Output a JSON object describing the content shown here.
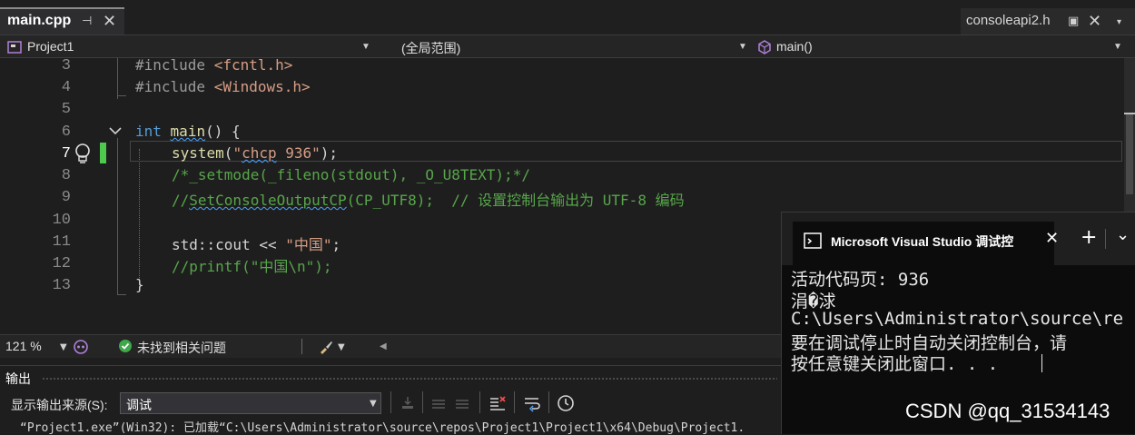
{
  "tabs": {
    "active": {
      "label": "main.cpp",
      "pin": "⊣",
      "close": "✕"
    },
    "right": {
      "label": "consoleapi2.h",
      "pin": "▣",
      "close": "✕",
      "overflow": "▾"
    }
  },
  "navbar": {
    "project": "Project1",
    "scope": "(全局范围)",
    "member": "main()"
  },
  "editor": {
    "lines": [
      {
        "num": "3"
      },
      {
        "num": "4"
      },
      {
        "num": "5"
      },
      {
        "num": "6"
      },
      {
        "num": "7"
      },
      {
        "num": "8"
      },
      {
        "num": "9"
      },
      {
        "num": "10"
      },
      {
        "num": "11"
      },
      {
        "num": "12"
      },
      {
        "num": "13"
      }
    ],
    "code": {
      "l3_pp": "#include ",
      "l3_inc": "<fcntl.h>",
      "l4_pp": "#include ",
      "l4_inc": "<Windows.h>",
      "l6_kw": "int",
      "l6_fn": "main",
      "l6_rest": "() {",
      "l7_fn": "system",
      "l7_open": "(",
      "l7_str_a": "\"",
      "l7_str_b": "chcp",
      "l7_str_c": " 936\"",
      "l7_close": ");",
      "l8_cm": "/*_setmode(_fileno(stdout), _O_U8TEXT);*/",
      "l9_cm_a": "//",
      "l9_cm_b": "SetConsoleOutputCP",
      "l9_cm_c": "(CP_UTF8);  // 设置控制台输出为 UTF-8 编码",
      "l11_a": "std::cout << ",
      "l11_str": "\"中国\"",
      "l11_b": ";",
      "l12_cm": "//printf(\"中国\\n\");",
      "l13": "}"
    }
  },
  "statusbar": {
    "zoom": "121 %",
    "issues": "未找到相关问题"
  },
  "output": {
    "title": "输出",
    "source_label": "显示输出来源(S):",
    "source_value": "调试",
    "line": "“Project1.exe”(Win32): 已加载“C:\\Users\\Administrator\\source\\repos\\Project1\\Project1\\x64\\Debug\\Project1."
  },
  "console": {
    "title": "Microsoft Visual Studio 调试控",
    "close": "✕",
    "add": "+",
    "dropdown": "⌄",
    "lines": [
      "活动代码页: 936",
      "涓�浗",
      "C:\\Users\\Administrator\\source\\re",
      "要在调试停止时自动关闭控制台，请",
      "按任意键关闭此窗口. . ."
    ]
  },
  "watermark": "CSDN @qq_31534143",
  "colors": {
    "accent_green": "#4ec94e",
    "keyword": "#569cd6",
    "comment": "#57a64a",
    "string": "#d69d85",
    "function": "#dcdcaa"
  }
}
